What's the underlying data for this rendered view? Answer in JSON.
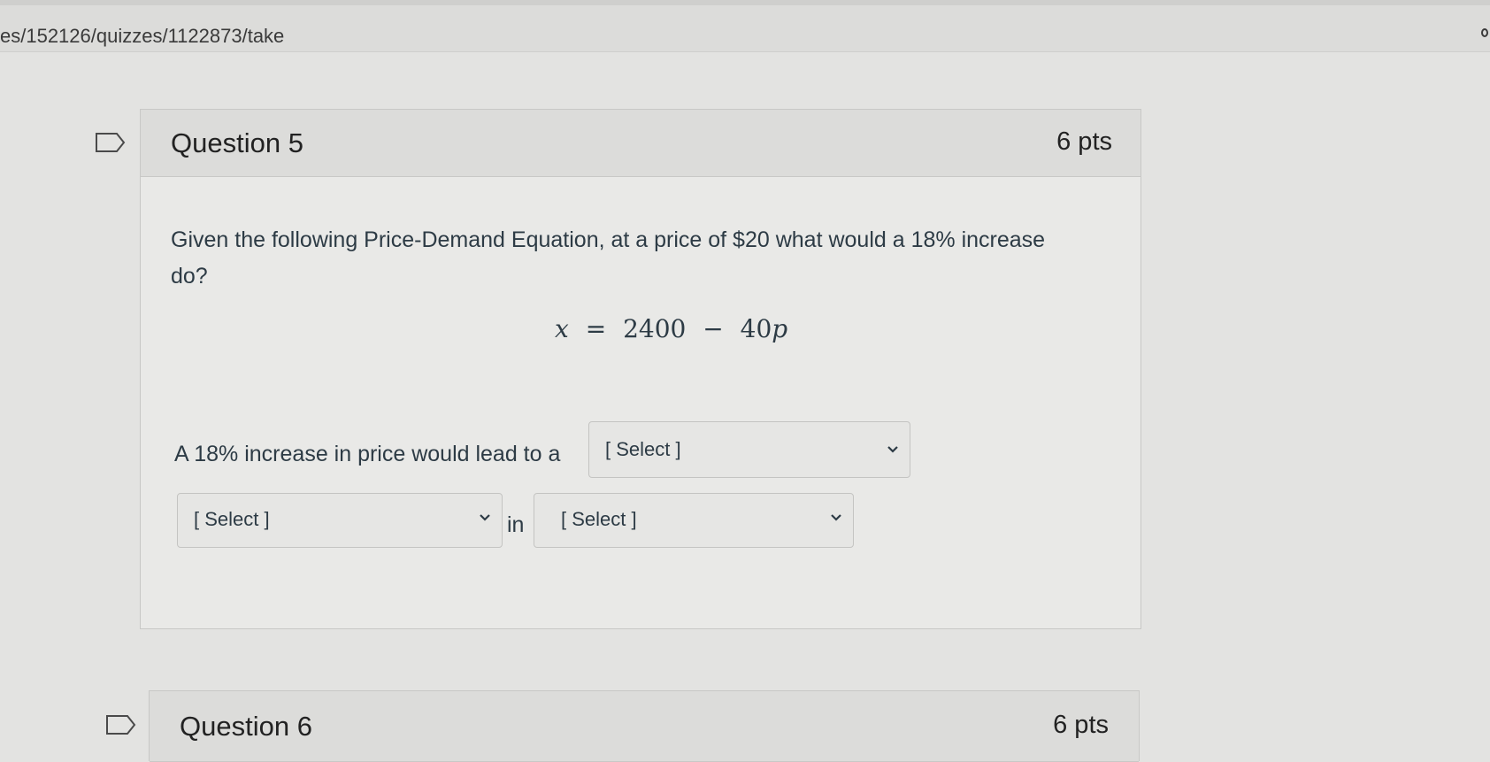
{
  "browser": {
    "url": "es/152126/quizzes/1122873/take"
  },
  "question5": {
    "title": "Question 5",
    "points": "6 pts",
    "prompt": "Given the following Price-Demand Equation, at a price of $20 what would a 18% increase do?",
    "equation": {
      "lhs": "x",
      "equals": "=",
      "constant": "2400",
      "minus": "−",
      "coefficient": "40",
      "variable": "p"
    },
    "sentence_lead": "A 18% increase in price would lead to a",
    "in_label": "in",
    "select1": {
      "value": "[ Select ]"
    },
    "select2": {
      "value": "[ Select ]"
    },
    "select3": {
      "value": "[ Select ]"
    }
  },
  "question6": {
    "title": "Question 6",
    "points": "6 pts"
  },
  "icons": {
    "flag": "flag-bookmark-icon",
    "dropdown": "chevron-down-icon"
  }
}
